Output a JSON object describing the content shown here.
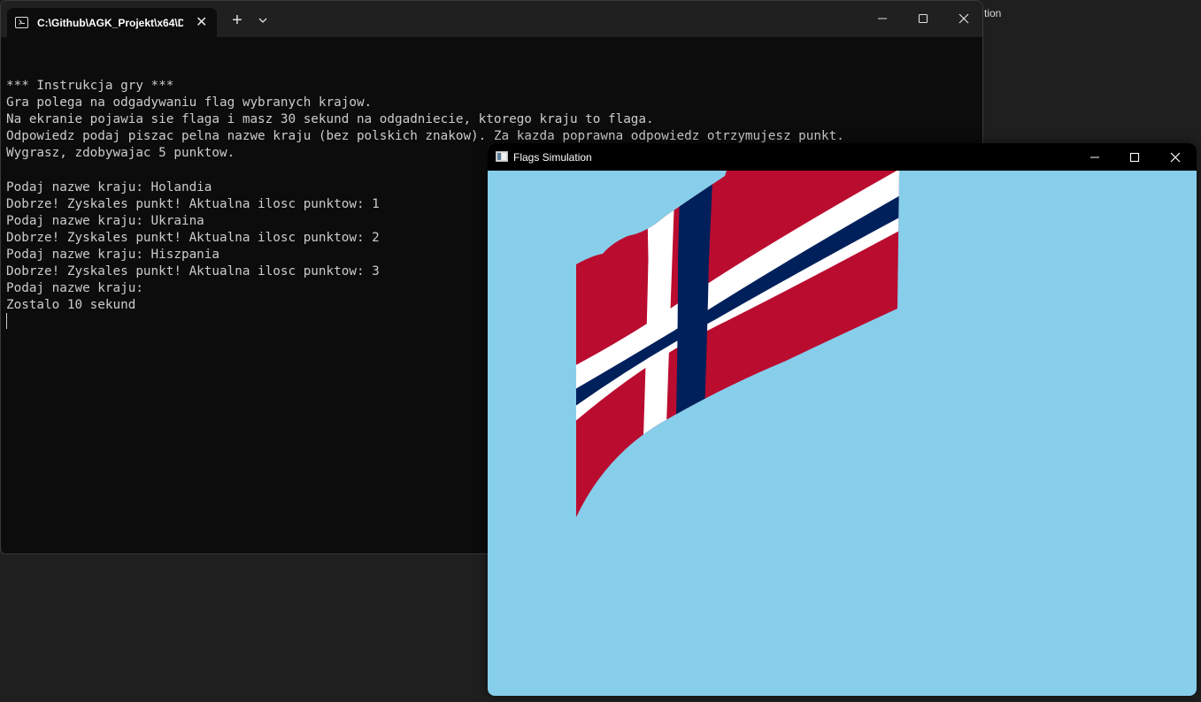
{
  "background_window": {
    "title_fragment": "tion"
  },
  "terminal": {
    "tab_title": "C:\\Github\\AGK_Projekt\\x64\\D",
    "tab_close_icon": "close-icon",
    "new_tab_label": "+",
    "lines": [
      "",
      "*** Instrukcja gry ***",
      "Gra polega na odgadywaniu flag wybranych krajow.",
      "Na ekranie pojawia sie flaga i masz 30 sekund na odgadniecie, ktorego kraju to flaga.",
      "Odpowiedz podaj piszac pelna nazwe kraju (bez polskich znakow). Za kazda poprawna odpowiedz otrzymujesz punkt.",
      "Wygrasz, zdobywajac 5 punktow.",
      "",
      "Podaj nazwe kraju: Holandia",
      "Dobrze! Zyskales punkt! Aktualna ilosc punktow: 1",
      "Podaj nazwe kraju: Ukraina",
      "Dobrze! Zyskales punkt! Aktualna ilosc punktow: 2",
      "Podaj nazwe kraju: Hiszpania",
      "Dobrze! Zyskales punkt! Aktualna ilosc punktow: 3",
      "Podaj nazwe kraju:",
      "Zostalo 10 sekund"
    ],
    "colors": {
      "background": "#0c0c0c",
      "titlebar": "#202020",
      "text": "#cccccc"
    }
  },
  "flags_window": {
    "title": "Flags Simulation",
    "colors": {
      "sky": "#87ceeb",
      "titlebar": "#000000",
      "flag_red": "#ba0c2f",
      "flag_white": "#ffffff",
      "flag_blue": "#00205b"
    },
    "flag": {
      "country": "Norway",
      "icon": "norway-flag"
    }
  },
  "icons": {
    "minimize": "minimize-icon",
    "maximize": "maximize-icon",
    "close": "close-icon",
    "dropdown": "chevron-down-icon"
  }
}
